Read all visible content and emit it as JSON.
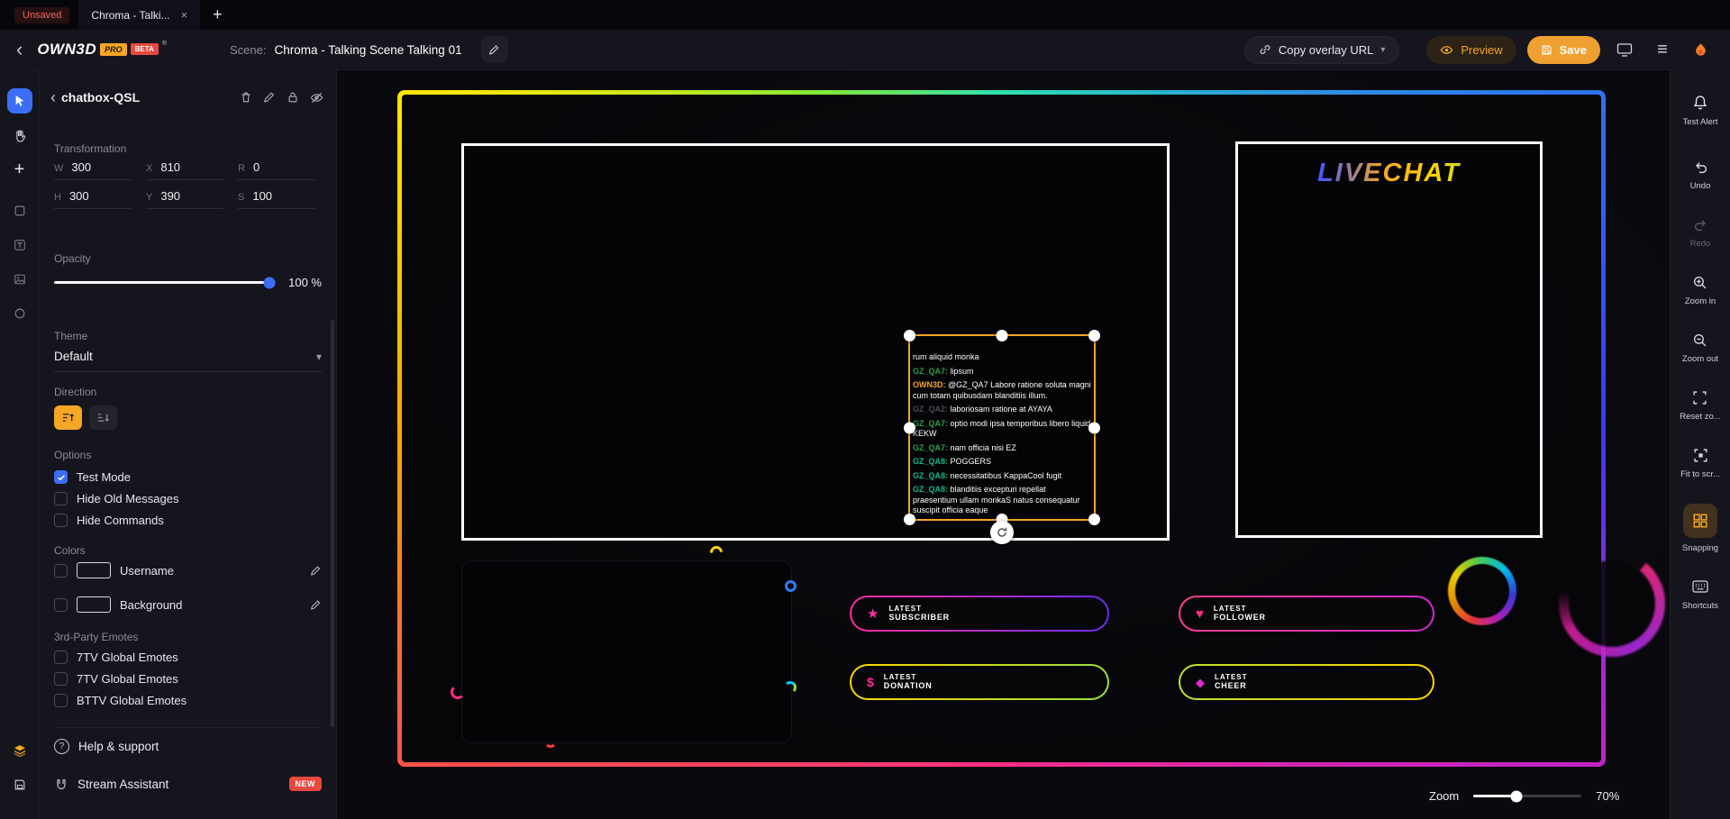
{
  "colors": {
    "accent_orange": "#F5A623",
    "accent_blue": "#3B6EF5",
    "danger_red": "#E8483F"
  },
  "tabbar": {
    "unsaved_badge": "Unsaved",
    "tab_title": "Chroma - Talki...",
    "close_glyph": "×",
    "new_tab_glyph": "+"
  },
  "header": {
    "logo_text": "OWN3D",
    "logo_pro": "PRO",
    "logo_beta": "BETA",
    "logo_reg": "®",
    "scene_label": "Scene:",
    "scene_name": "Chroma - Talking Scene Talking 01",
    "copy_overlay_label": "Copy overlay URL",
    "preview_label": "Preview",
    "save_label": "Save"
  },
  "panel": {
    "back_glyph": "‹",
    "title": "chatbox-QSL",
    "transformation": {
      "heading": "Transformation",
      "fields": [
        {
          "label": "W",
          "value": "300"
        },
        {
          "label": "X",
          "value": "810"
        },
        {
          "label": "R",
          "value": "0"
        },
        {
          "label": "H",
          "value": "300"
        },
        {
          "label": "Y",
          "value": "390"
        },
        {
          "label": "S",
          "value": "100"
        }
      ]
    },
    "opacity": {
      "heading": "Opacity",
      "value_label": "100 %",
      "percent": 100
    },
    "theme": {
      "heading": "Theme",
      "selected": "Default",
      "chevron": "▾"
    },
    "direction": {
      "heading": "Direction"
    },
    "options": {
      "heading": "Options",
      "items": [
        {
          "label": "Test Mode",
          "checked": true
        },
        {
          "label": "Hide Old Messages",
          "checked": false
        },
        {
          "label": "Hide Commands",
          "checked": false
        }
      ]
    },
    "colors_section": {
      "heading": "Colors",
      "items": [
        {
          "label": "Username"
        },
        {
          "label": "Background"
        }
      ]
    },
    "emotes": {
      "heading": "3rd-Party Emotes",
      "items": [
        {
          "label": "7TV Global Emotes",
          "checked": false
        },
        {
          "label": "7TV Global Emotes",
          "checked": false
        },
        {
          "label": "BTTV Global Emotes",
          "checked": false
        }
      ]
    },
    "help_label": "Help & support",
    "assistant_label": "Stream Assistant",
    "assistant_badge": "NEW"
  },
  "canvas": {
    "livechat_title": "LIVECHAT",
    "chat_messages": [
      {
        "user": "",
        "color": "#FFFFFF",
        "text": "rum aliquid monka"
      },
      {
        "user": "GZ_QA7:",
        "color": "#2F9E44",
        "text": " lipsum"
      },
      {
        "user": "OWN3D:",
        "color": "#F5A623",
        "text": " @GZ_QA7 Labore ratione soluta magni cum totam quibusdam blanditiis illum."
      },
      {
        "user": "GZ_QA2:",
        "color": "#4A4A55",
        "text": " laboriosam ratione at AYAYA"
      },
      {
        "user": "GZ_QA7:",
        "color": "#2F9E44",
        "text": " optio modi ipsa temporibus libero liquid KEKW"
      },
      {
        "user": "GZ_QA7:",
        "color": "#2F9E44",
        "text": " nam officia nisi EZ"
      },
      {
        "user": "GZ_QA8:",
        "color": "#12B886",
        "text": " POGGERS"
      },
      {
        "user": "GZ_QA8:",
        "color": "#12B886",
        "text": " necessitatibus KappaCool fugit"
      },
      {
        "user": "GZ_QA8:",
        "color": "#12B886",
        "text": " blanditiis excepturi repellat praesentium ullam monkaS natus consequatur suscipit officia eaque"
      }
    ],
    "widgets": [
      {
        "line1": "LATEST",
        "line2": "SUBSCRIBER",
        "icon": "star",
        "icon_color": "#FF2DA0",
        "c1": "#FF2DA0",
        "c2": "#6A2BF0"
      },
      {
        "line1": "LATEST",
        "line2": "FOLLOWER",
        "icon": "heart",
        "icon_color": "#FF2D86",
        "c1": "#FF3D8E",
        "c2": "#D02BD0"
      },
      {
        "line1": "LATEST",
        "line2": "DONATION",
        "icon": "dollar",
        "icon_color": "#FF2DA0",
        "c1": "#FFD500",
        "c2": "#9AE03C"
      },
      {
        "line1": "LATEST",
        "line2": "CHEER",
        "icon": "diamond",
        "icon_color": "#E02BD0",
        "c1": "#BFE02C",
        "c2": "#FFD500"
      }
    ],
    "zoom": {
      "label": "Zoom",
      "value": "70%",
      "slider_percent": 40
    }
  },
  "right_toolbar": {
    "items": [
      {
        "label": "Test Alert"
      },
      {
        "label": "Undo"
      },
      {
        "label": "Redo"
      },
      {
        "label": "Zoom in"
      },
      {
        "label": "Zoom out"
      },
      {
        "label": "Reset zo..."
      },
      {
        "label": "Fit to scr..."
      },
      {
        "label": "Snapping"
      },
      {
        "label": "Shortcuts"
      }
    ]
  }
}
